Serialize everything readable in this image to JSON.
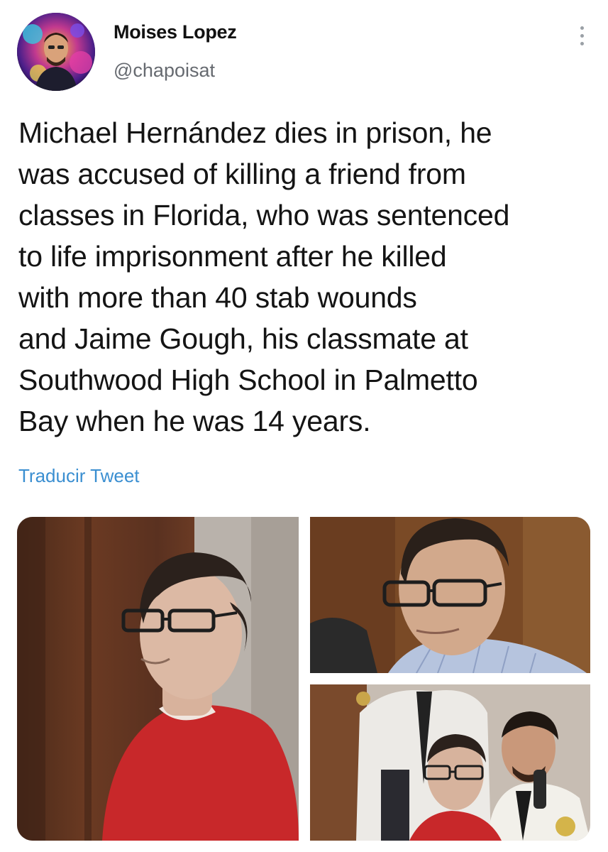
{
  "tweet": {
    "author": {
      "display_name": "Moises Lopez",
      "handle": "@chapoisat"
    },
    "text": "Michael Hernández dies in prison, he\nwas accused of killing a friend from\nclasses in Florida, who was sentenced\nto life imprisonment after he killed\nwith more than 40 stab wounds\nand Jaime Gough, his classmate at\nSouthwood High School in Palmetto\nBay when he was 14 years.",
    "translate_label": "Traducir Tweet",
    "more_icon": "vertical-ellipsis-icon",
    "photos": [
      {
        "subject": "man in red jumpsuit with glasses in courtroom"
      },
      {
        "subject": "man with glasses in striped shirt"
      },
      {
        "subject": "man in red jumpsuit escorted by officers"
      }
    ]
  },
  "colors": {
    "text": "#141414",
    "secondary": "#666a70",
    "link": "#3b8fd1",
    "icon": "#9aa0a6",
    "background": "#ffffff"
  }
}
